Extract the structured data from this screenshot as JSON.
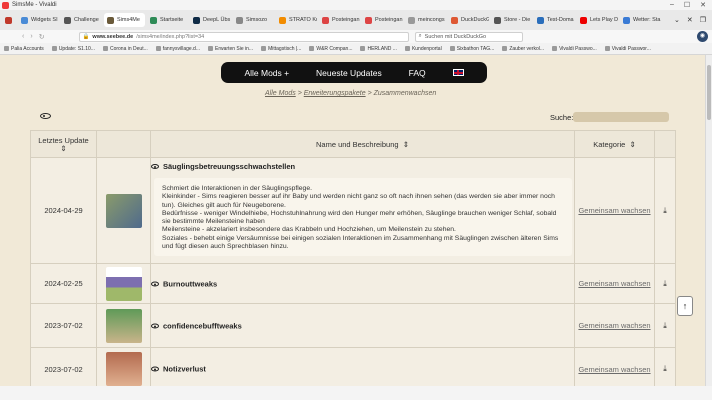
{
  "window": {
    "title": "SimsMe - Vivaldi"
  },
  "tabs": [
    {
      "label": "",
      "fav": "#c0392b"
    },
    {
      "label": "Widgets SI",
      "fav": "#4a8bd6"
    },
    {
      "label": "Challenge",
      "fav": "#555"
    },
    {
      "label": "Sims4Me",
      "fav": "#6a5a3a",
      "active": true
    },
    {
      "label": "Startseite",
      "fav": "#2e8b57"
    },
    {
      "label": "DeepL Übs",
      "fav": "#0f2b46"
    },
    {
      "label": "Simsozo",
      "fav": "#888"
    },
    {
      "label": "STRATO Ku",
      "fav": "#f28c00"
    },
    {
      "label": "Posteingan",
      "fav": "#d44"
    },
    {
      "label": "Posteingan",
      "fav": "#d44"
    },
    {
      "label": "meincongs",
      "fav": "#999"
    },
    {
      "label": "DuckDuckG",
      "fav": "#de5833"
    },
    {
      "label": "Store - Die",
      "fav": "#555"
    },
    {
      "label": "Test-Doma",
      "fav": "#2a6ebb"
    },
    {
      "label": "Lets Play D",
      "fav": "#e00"
    },
    {
      "label": "Wetter: Sta",
      "fav": "#3a7bd5"
    }
  ],
  "address": {
    "host": "www.seebee.de",
    "rest": "/sims4me/index.php?list=34",
    "search_placeholder": "Suchen mit DuckDuckGo"
  },
  "bookmarks": [
    "Palia Accounts",
    "Update: S1.10...",
    "Corona in Deut...",
    "fannysvillage.d...",
    "Erwarten Sie in...",
    "Mittagstisch |...",
    "W&R Compan...",
    "HERLAND ...",
    "Kundenportal",
    "Sixbathon TAG...",
    "Zauber verkol...",
    "Vivaldi Passwo...",
    "Vivaldi Passwor..."
  ],
  "nav": {
    "all_mods": "Alle Mods",
    "plus": "+",
    "newest": "Neueste Updates",
    "faq": "FAQ"
  },
  "breadcrumb": {
    "a": "Alle Mods",
    "sep1": ">",
    "b": "Erweiterungspakete",
    "sep2": ">",
    "c": "Zusammenwachsen"
  },
  "search": {
    "label": "Suche:"
  },
  "table": {
    "col_date": "Letztes Update",
    "col_name": "Name und Beschreibung",
    "col_cat": "Kategorie",
    "sort_icon": "⇕",
    "rows": [
      {
        "date": "2024-04-29",
        "name": "Säuglingsbetreuungsschwachstellen",
        "category": "Gemeinsam wachsen",
        "thumb": "#8a9b6b",
        "desc": [
          "Schmiert die Interaktionen in der Säuglingspflege.",
          "Kleinkinder - Sims reagieren besser auf ihr Baby und werden nicht ganz so oft nach ihnen sehen (das werden sie aber immer noch tun). Gleiches gilt auch für Neugeborene.",
          "Bedürfnisse - weniger Windelhiebe, Hochstuhlnahrung wird den Hunger mehr erhöhen, Säuglinge brauchen weniger Schlaf, sobald sie bestimmte Meilensteine haben",
          "Meilensteine - akzelariert insbesondere das Krabbeln und Hochziehen, um Meilenstein zu stehen.",
          "Soziales - behebt einige Versäumnisse bei einigen sozialen Interaktionen im Zusammenhang mit Säuglingen zwischen älteren Sims und fügt diesen auch Sprechblasen hinzu."
        ]
      },
      {
        "date": "2024-02-25",
        "name": "Burnouttweaks",
        "category": "Gemeinsam wachsen",
        "thumb": "#7d6fb0"
      },
      {
        "date": "2023-07-02",
        "name": "confidencebufftweaks",
        "category": "Gemeinsam wachsen",
        "thumb": "#6fa06a"
      },
      {
        "date": "2023-07-02",
        "name": "Notizverlust",
        "category": "Gemeinsam wachsen",
        "thumb": "#b36b4f"
      }
    ]
  }
}
